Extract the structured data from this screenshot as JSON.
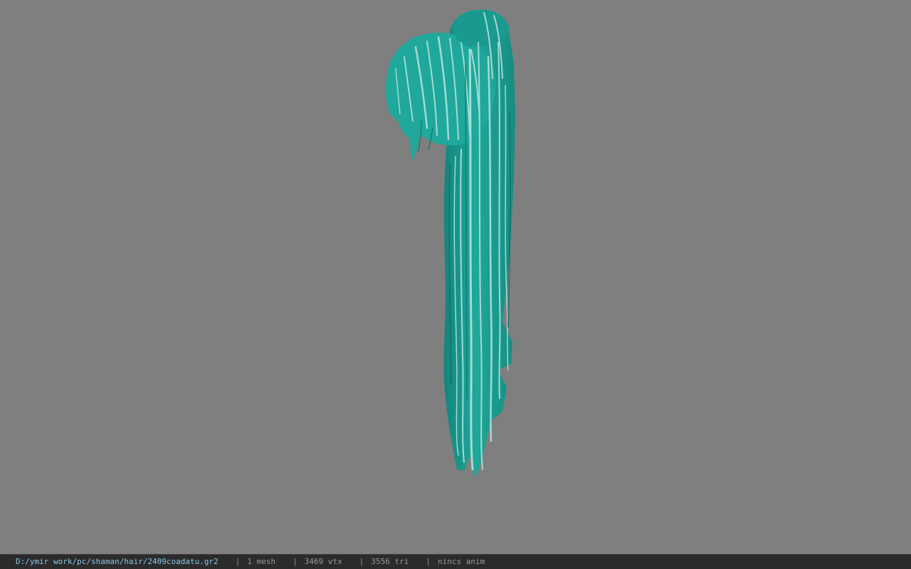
{
  "viewport": {
    "background": "#7f7f7f",
    "model": {
      "name": "hair-mesh",
      "base_color": "#1fa89b",
      "highlight_color": "#b9e6df",
      "dark_color": "#13756c"
    }
  },
  "statusbar": {
    "path": "D:/ymir work/pc/shaman/hair/2409coadatu.gr2",
    "separator": "|",
    "mesh": "1 mesh",
    "vtx": "3469 vtx",
    "tri": "3556 tri",
    "anim": "nincs anim"
  }
}
